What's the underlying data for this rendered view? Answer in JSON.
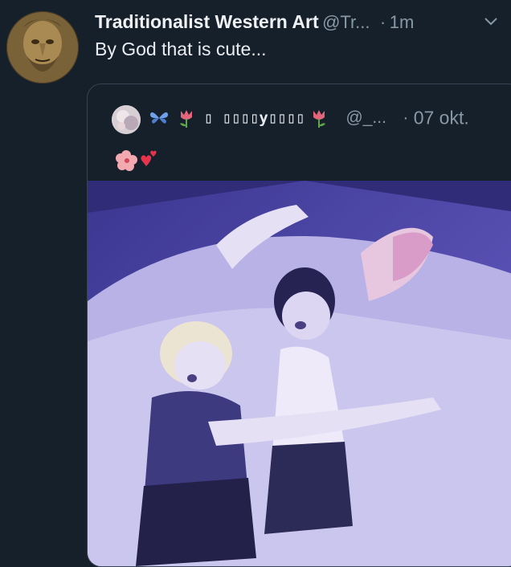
{
  "tweet": {
    "author_name": "Traditionalist Western Art",
    "author_handle": "@Tr...",
    "separator": "·",
    "time": "1m",
    "text": "By God that is cute..."
  },
  "quote": {
    "author_name": "▯ ▯▯▯▯y▯▯▯▯",
    "author_handle": "@_...",
    "separator": "·",
    "time": "07 okt."
  },
  "icons": {
    "avatar": "bearded-statue-avatar",
    "menu": "chevron-down-icon",
    "quote_avatar": "pastel-avatar",
    "emojis": [
      "butterfly-emoji",
      "tulip-emoji",
      "tulip-emoji",
      "hibiscus-emoji",
      "hearts-emoji"
    ]
  },
  "colors": {
    "background": "#16202b",
    "secondary_text": "#8899a6",
    "quote_border": "#384451",
    "image_tint": "#5b52b8"
  }
}
